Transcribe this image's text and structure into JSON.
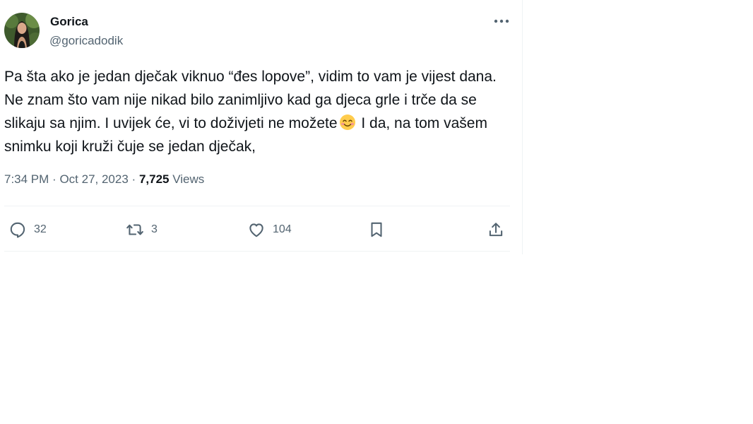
{
  "user": {
    "display_name": "Gorica",
    "handle": "@goricadodik"
  },
  "tweet": {
    "text_part1": "Pa šta ako je jedan dječak viknuo “đes lopove”, vidim to vam je vijest dana. Ne znam što vam nije nikad bilo zanimljivo kad ga djeca grle i trče da se slikaju sa njim. I uvijek će, vi to doživjeti ne možete",
    "emoji": "smiling-face-with-smiling-eyes",
    "text_part2": " I da, na tom vašem snimku koji kruži čuje se jedan dječak,",
    "time": "7:34 PM",
    "date": "Oct 27, 2023",
    "separator": "·",
    "views_count": "7,725",
    "views_label": "Views"
  },
  "actions": {
    "replies": "32",
    "retweets": "3",
    "likes": "104"
  },
  "colors": {
    "text": "#0f1419",
    "secondary": "#536471",
    "border": "#eff3f4"
  }
}
